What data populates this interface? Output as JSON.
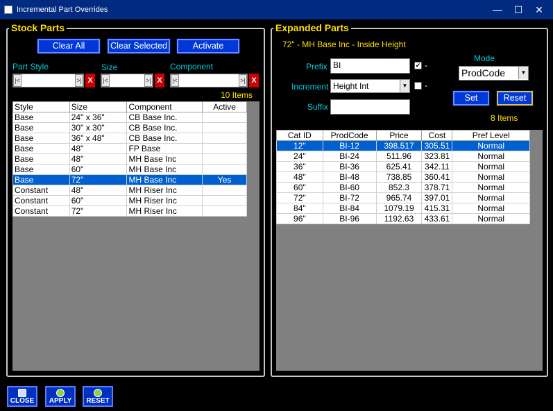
{
  "window": {
    "title": "Incremental Part Overrides",
    "minimize": "—",
    "maximize": "☐",
    "close": "✕"
  },
  "stock": {
    "legend": "Stock Parts",
    "buttons": {
      "clear_all": "Clear All",
      "clear_selected": "Clear Selected",
      "activate": "Activate"
    },
    "filters": {
      "part_style": "Part Style",
      "size": "Size",
      "component": "Component"
    },
    "nav_first": "|<",
    "nav_last": ">|",
    "clear_x": "X",
    "count": "10 Items",
    "columns": [
      "Style",
      "Size",
      "Component",
      "Active"
    ],
    "rows": [
      [
        "Base",
        "24\" x 36\"",
        "CB Base Inc.",
        ""
      ],
      [
        "Base",
        "30\" x 30\"",
        "CB Base Inc.",
        ""
      ],
      [
        "Base",
        "36\" x 48\"",
        "CB Base Inc.",
        ""
      ],
      [
        "Base",
        "48\"",
        "FP Base",
        ""
      ],
      [
        "Base",
        "48\"",
        "MH Base Inc",
        ""
      ],
      [
        "Base",
        "60\"",
        "MH Base Inc",
        ""
      ],
      [
        "Base",
        "72\"",
        "MH Base Inc",
        "Yes"
      ],
      [
        "Constant",
        "48\"",
        "MH Riser Inc",
        ""
      ],
      [
        "Constant",
        "60\"",
        "MH Riser Inc",
        ""
      ],
      [
        "Constant",
        "72\"",
        "MH Riser Inc",
        ""
      ]
    ],
    "selected_row": 6
  },
  "expanded": {
    "legend": "Expanded Parts",
    "subtitle": "72\" - MH Base Inc - Inside Height",
    "prefix_label": "Prefix",
    "prefix_value": "BI",
    "increment_label": "Increment",
    "increment_value": "Height Int",
    "suffix_label": "Suffix",
    "suffix_value": "",
    "check_mark": "✔",
    "dash": "-",
    "mode_label": "Mode",
    "mode_value": "ProdCode",
    "set_label": "Set",
    "reset_label": "Reset",
    "count": "8 Items",
    "columns": [
      "Cat ID",
      "ProdCode",
      "Price",
      "Cost",
      "Pref Level"
    ],
    "rows": [
      [
        "12\"",
        "BI-12",
        "398.517",
        "305.51",
        "Normal"
      ],
      [
        "24\"",
        "BI-24",
        "511.96",
        "323.81",
        "Normal"
      ],
      [
        "36\"",
        "BI-36",
        "625.41",
        "342.11",
        "Normal"
      ],
      [
        "48\"",
        "BI-48",
        "738.85",
        "360.41",
        "Normal"
      ],
      [
        "60\"",
        "BI-60",
        "852.3",
        "378.71",
        "Normal"
      ],
      [
        "72\"",
        "BI-72",
        "965.74",
        "397.01",
        "Normal"
      ],
      [
        "84\"",
        "BI-84",
        "1079.19",
        "415.31",
        "Normal"
      ],
      [
        "96\"",
        "BI-96",
        "1192.63",
        "433.61",
        "Normal"
      ]
    ],
    "selected_row": 0
  },
  "bottom": {
    "close": "CLOSE",
    "apply": "APPLY",
    "reset": "RESET"
  }
}
